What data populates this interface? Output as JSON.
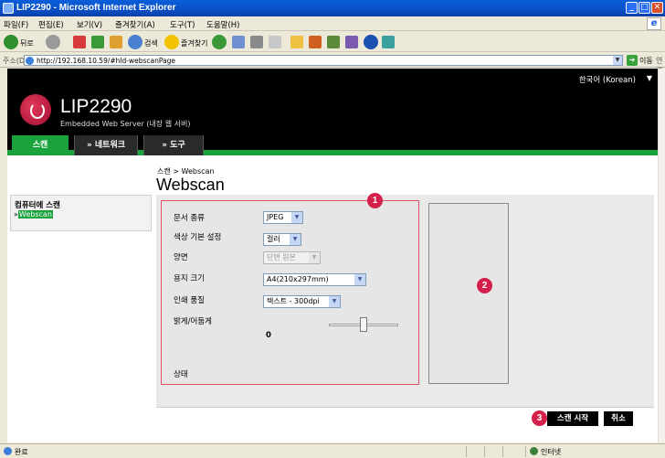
{
  "window": {
    "title": "LIP2290 - Microsoft Internet Explorer"
  },
  "menu": [
    "파일(F)",
    "편집(E)",
    "보기(V)",
    "즐겨찾기(A)",
    "도구(T)",
    "도움말(H)"
  ],
  "toolbar": {
    "back_label": "뒤로",
    "search_label": "검색",
    "favorites_label": "즐겨찾기"
  },
  "address": {
    "label": "주소(D)",
    "url": "http://192.168.10.59/#hld-webscanPage",
    "go_label": "이동",
    "links_label": "연결"
  },
  "header": {
    "language": "한국어 (Korean)",
    "product_name": "LIP2290",
    "subtitle": "Embedded Web Server (내장 웹 서버)",
    "tabs": [
      "스캔",
      "» 네트워크",
      "» 도구"
    ]
  },
  "breadcrumb": "스캔 > Webscan",
  "page_title": "Webscan",
  "leftnav": {
    "heading": "컴퓨터에 스캔",
    "prefix": "»",
    "item": "Webscan"
  },
  "form": {
    "doc_type": {
      "label": "문서 종류",
      "value": "JPEG"
    },
    "color": {
      "label": "색상 기본 설정",
      "value": "컬러"
    },
    "duplex": {
      "label": "양면",
      "value": "단면 원본"
    },
    "paper": {
      "label": "용지 크기",
      "value": "A4(210x297mm)"
    },
    "quality": {
      "label": "인쇄 품질",
      "value": "텍스트 - 300dpi"
    },
    "brightness": {
      "label": "밝게/어둡게",
      "value": "0"
    },
    "status": {
      "label": "상태"
    }
  },
  "markers": [
    "1",
    "2",
    "3"
  ],
  "buttons": {
    "start": "스캔 시작",
    "cancel": "취소"
  },
  "status": {
    "text": "완료",
    "zone": "인터넷"
  },
  "colors": {
    "accent_green": "#1aa33c",
    "marker_red": "#d4204a",
    "header_bg": "#000000"
  }
}
